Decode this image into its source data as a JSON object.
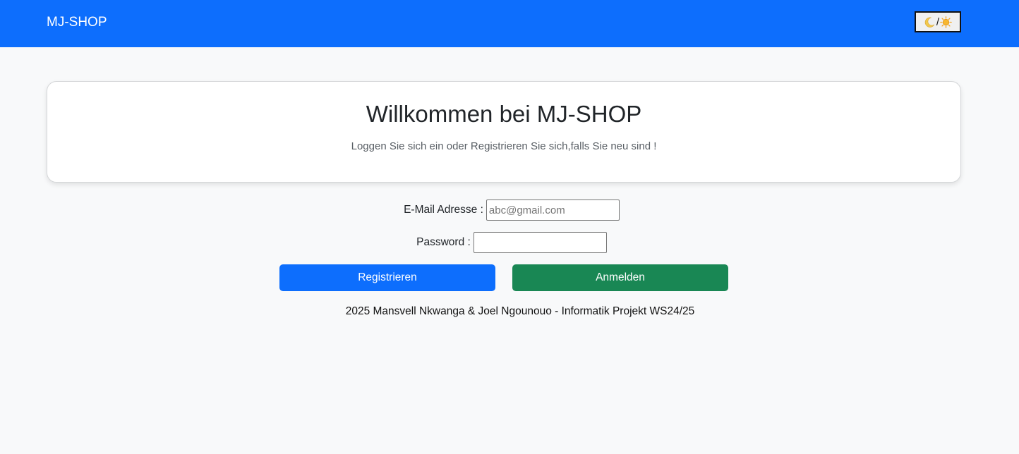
{
  "navbar": {
    "brand": "MJ-SHOP",
    "theme_toggle": {
      "moon_icon": "moon-icon",
      "separator": "/",
      "sun_icon": "sun-icon"
    }
  },
  "welcome": {
    "title": "Willkommen bei MJ-SHOP",
    "text": "Loggen Sie sich ein oder Registrieren Sie sich,falls Sie neu sind !"
  },
  "form": {
    "email_label": "E-Mail Adresse :",
    "email_placeholder": "abc@gmail.com",
    "email_value": "",
    "password_label": "Password :",
    "password_value": "",
    "register_label": "Registrieren",
    "login_label": "Anmelden"
  },
  "footer": {
    "text": "2025 Mansvell Nkwanga & Joel Ngounouo - Informatik Projekt WS24/25"
  },
  "colors": {
    "primary": "#0d6efd",
    "success": "#198754",
    "background": "#f8f9fa"
  }
}
